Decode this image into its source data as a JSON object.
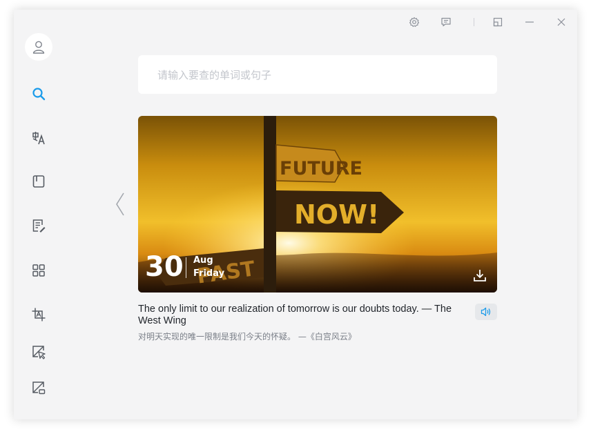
{
  "theme": {
    "accent": "#1a9bea",
    "icon_color": "#555a62"
  },
  "titlebar": {
    "icons": [
      "settings-icon",
      "feedback-icon",
      "compact-mode-icon",
      "minimize-icon",
      "close-icon"
    ]
  },
  "sidebar": {
    "avatar_icon": "user-icon",
    "items": [
      {
        "icon": "search-icon",
        "active": true
      },
      {
        "icon": "translate-icon",
        "active": false
      },
      {
        "icon": "book-icon",
        "active": false
      },
      {
        "icon": "document-edit-icon",
        "active": false
      },
      {
        "icon": "grid-icon",
        "active": false
      },
      {
        "icon": "screenshot-translate-icon",
        "active": false
      },
      {
        "icon": "pointer-translate-icon",
        "active": false
      },
      {
        "icon": "screen-capture-icon",
        "active": false
      }
    ]
  },
  "search": {
    "placeholder": "请输入要查的单词或句子",
    "value": ""
  },
  "daily": {
    "day": "30",
    "month": "Aug",
    "weekday": "Friday",
    "sign_texts": {
      "top": "FUTURE",
      "middle": "NOW!",
      "bottom": "PAST"
    },
    "quote_en": "The only limit to our realization of tomorrow is our doubts today. — The West Wing",
    "quote_zh": "对明天实现的唯一限制是我们今天的怀疑。 —《白宫风云》"
  }
}
